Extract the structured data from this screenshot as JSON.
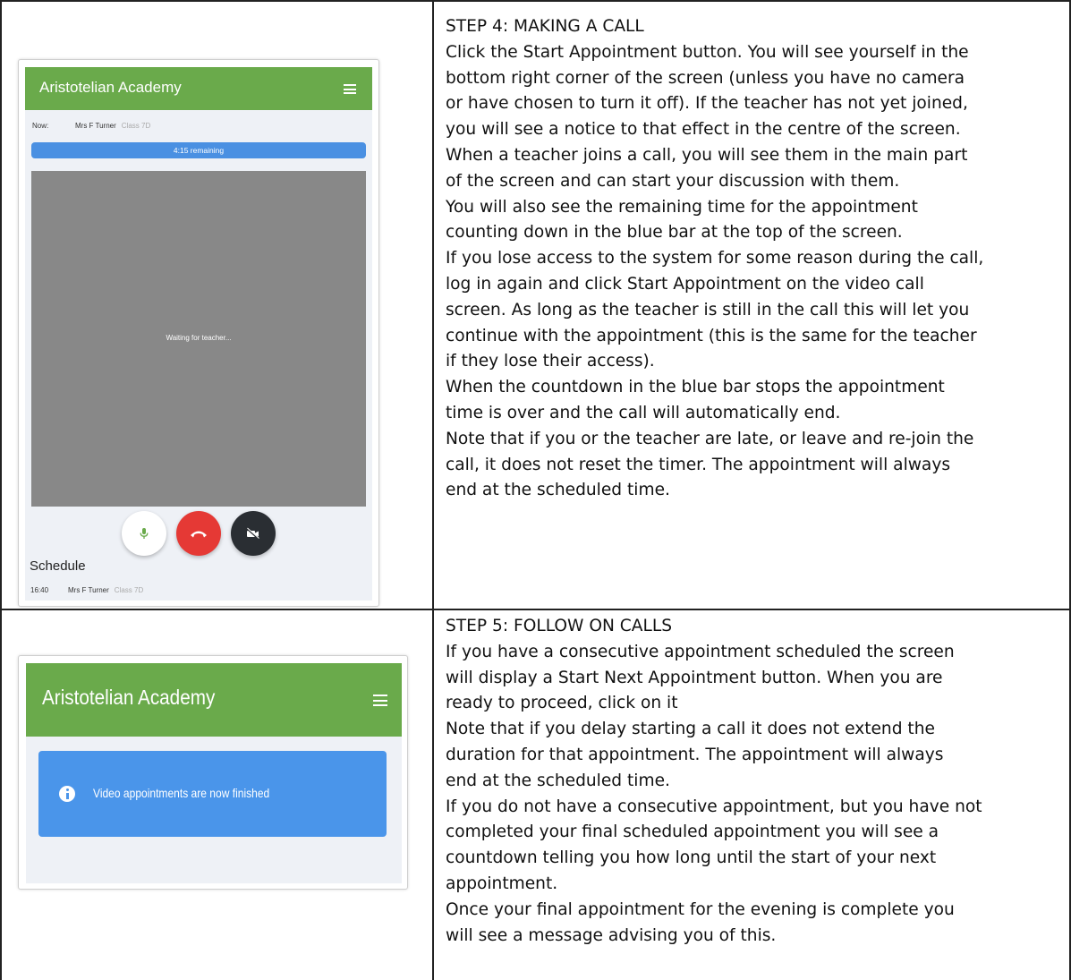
{
  "step4": {
    "title": "STEP 4: MAKING A CALL",
    "lines": [
      "Click the Start Appointment button. You will see yourself in the",
      "bottom right corner of the screen (unless you have no camera",
      "or have chosen to turn it off). If the teacher has not yet joined,",
      "you will see a notice to that effect in the centre of the screen.",
      "When a teacher joins a call, you will see them in the main part",
      "of the screen and can start your discussion with them.",
      "You will also see the remaining time for the appointment",
      "counting down in the blue bar at the top of the screen.",
      "If you lose access to the system for some reason during the call,",
      "log in again and click Start Appointment on the video call",
      "screen. As long as the teacher is still in the call this will let you",
      "continue with the appointment (this is the same for the teacher",
      "if they lose their access).",
      "When the countdown in the blue bar stops the appointment",
      "time is over and the call will automatically end.",
      "Note that if you or the teacher are late, or leave and re-join the",
      "call, it does not reset the timer. The appointment will always",
      "end at the scheduled time."
    ]
  },
  "step5": {
    "title": "STEP 5: FOLLOW ON CALLS",
    "lines": [
      "If you have a consecutive appointment scheduled the screen",
      "will display a Start Next Appointment button. When you are",
      "ready to proceed, click on it",
      "Note that if you delay starting a call it does not extend the",
      "duration for that appointment. The appointment will always",
      "end at the scheduled time.",
      "If you do not have a consecutive appointment, but you have not",
      "completed your final scheduled appointment you will see a",
      "countdown telling you how long until the start of your next",
      "appointment.",
      "Once your final appointment for the evening is complete you",
      "will see a message advising you of this."
    ]
  },
  "call_screen": {
    "app_title": "Aristotelian Academy",
    "now_label": "Now:",
    "now_teacher": "Mrs F Turner",
    "now_class": "Class 7D",
    "countdown": "4:15 remaining",
    "waiting_text": "Waiting for teacher...",
    "schedule_title": "Schedule",
    "schedule_time": "16:40",
    "schedule_teacher": "Mrs F Turner",
    "schedule_class": "Class 7D",
    "colors": {
      "header": "#6aaa4b",
      "countdown_bar": "#4a90e2",
      "hangup": "#e53935",
      "mic": "#6aaa4b",
      "video_area": "#888888"
    }
  },
  "finished_screen": {
    "app_title": "Aristotelian Academy",
    "message": "Video appointments are now finished",
    "colors": {
      "header": "#6aaa4b",
      "alert": "#4a95ea"
    }
  }
}
